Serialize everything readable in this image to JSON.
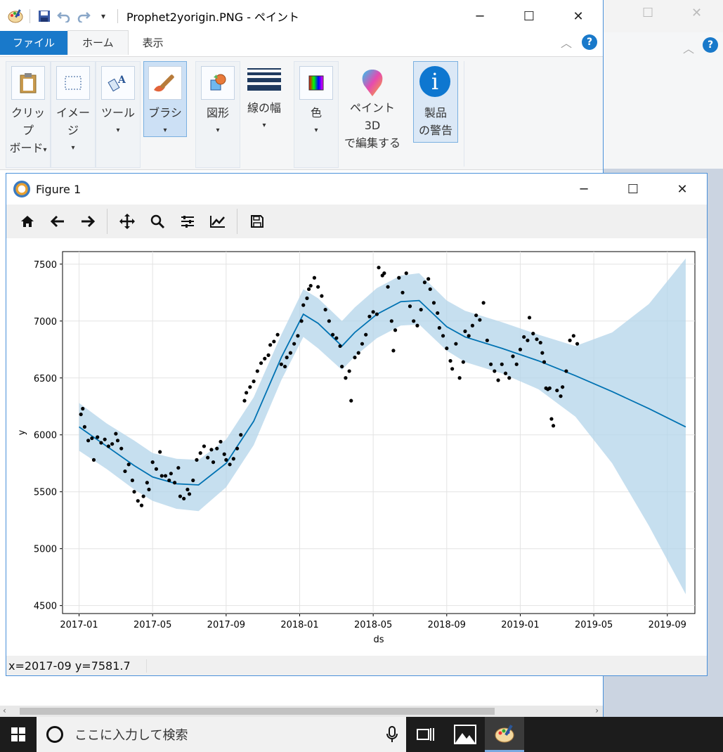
{
  "paint": {
    "title": "Prophet2yorigin.PNG - ペイント",
    "tabs": {
      "file": "ファイル",
      "home": "ホーム",
      "view": "表示"
    },
    "ribbon": {
      "clipboard": [
        "クリップ",
        "ボード"
      ],
      "image": "イメージ",
      "tools": "ツール",
      "brush": "ブラシ",
      "shapes": "図形",
      "size": "線の幅",
      "color": "色",
      "paint3d": [
        "ペイント 3D",
        "で編集する"
      ],
      "warning": [
        "製品",
        "の警告"
      ]
    }
  },
  "figure": {
    "title": "Figure 1",
    "status": "x=2017-09 y=7581.7"
  },
  "taskbar": {
    "search_placeholder": "ここに入力して検索"
  },
  "chart_data": {
    "type": "line",
    "xlabel": "ds",
    "ylabel": "y",
    "x_ticks": [
      "2017-01",
      "2017-05",
      "2017-09",
      "2018-01",
      "2018-05",
      "2018-09",
      "2019-01",
      "2019-05",
      "2019-09"
    ],
    "y_ticks": [
      4500,
      5000,
      5500,
      6000,
      6500,
      7000,
      7500
    ],
    "ylim": [
      4430,
      7610
    ],
    "xlim_months": [
      -0.9,
      33.5
    ],
    "grid": true,
    "series": [
      {
        "kind": "forecast",
        "color": "#0072b2",
        "x_month": [
          0,
          1.5,
          3,
          4,
          5.3,
          6.5,
          8,
          9.5,
          11,
          12.2,
          13,
          14.3,
          15,
          16.2,
          17.5,
          18.5,
          20,
          21,
          23,
          25,
          27,
          29,
          31,
          33
        ],
        "y": [
          6070,
          5900,
          5730,
          5630,
          5570,
          5560,
          5750,
          6120,
          6680,
          7060,
          6980,
          6780,
          6900,
          7060,
          7170,
          7180,
          6950,
          6860,
          6760,
          6650,
          6520,
          6380,
          6230,
          6070
        ],
        "upper": [
          6280,
          6100,
          5950,
          5840,
          5790,
          5780,
          5960,
          6330,
          6880,
          7280,
          7200,
          7000,
          7120,
          7290,
          7400,
          7420,
          7180,
          7090,
          6990,
          6880,
          6780,
          6900,
          7150,
          7550
        ],
        "lower": [
          5860,
          5700,
          5520,
          5420,
          5350,
          5330,
          5540,
          5910,
          6480,
          6860,
          6760,
          6570,
          6690,
          6850,
          6960,
          6970,
          6740,
          6640,
          6540,
          6400,
          6160,
          5750,
          5200,
          4600
        ]
      }
    ],
    "actuals": [
      [
        0.1,
        6180
      ],
      [
        0.2,
        6230
      ],
      [
        0.3,
        6070
      ],
      [
        0.5,
        5950
      ],
      [
        0.7,
        5970
      ],
      [
        0.8,
        5780
      ],
      [
        1.0,
        5980
      ],
      [
        1.2,
        5930
      ],
      [
        1.4,
        5960
      ],
      [
        1.6,
        5900
      ],
      [
        1.8,
        5920
      ],
      [
        2.0,
        6010
      ],
      [
        2.1,
        5950
      ],
      [
        2.3,
        5880
      ],
      [
        2.5,
        5680
      ],
      [
        2.7,
        5740
      ],
      [
        2.9,
        5600
      ],
      [
        3.0,
        5500
      ],
      [
        3.2,
        5420
      ],
      [
        3.4,
        5380
      ],
      [
        3.5,
        5460
      ],
      [
        3.7,
        5580
      ],
      [
        3.8,
        5520
      ],
      [
        4.0,
        5760
      ],
      [
        4.2,
        5700
      ],
      [
        4.4,
        5850
      ],
      [
        4.5,
        5640
      ],
      [
        4.7,
        5640
      ],
      [
        4.9,
        5600
      ],
      [
        5.0,
        5660
      ],
      [
        5.2,
        5580
      ],
      [
        5.4,
        5710
      ],
      [
        5.5,
        5460
      ],
      [
        5.7,
        5440
      ],
      [
        5.9,
        5520
      ],
      [
        6.0,
        5480
      ],
      [
        6.2,
        5600
      ],
      [
        6.4,
        5780
      ],
      [
        6.6,
        5840
      ],
      [
        6.8,
        5900
      ],
      [
        7.0,
        5800
      ],
      [
        7.2,
        5870
      ],
      [
        7.3,
        5760
      ],
      [
        7.5,
        5880
      ],
      [
        7.7,
        5940
      ],
      [
        7.9,
        5830
      ],
      [
        8.0,
        5780
      ],
      [
        8.2,
        5740
      ],
      [
        8.4,
        5790
      ],
      [
        8.6,
        5880
      ],
      [
        8.8,
        6000
      ],
      [
        9.0,
        6300
      ],
      [
        9.1,
        6370
      ],
      [
        9.3,
        6420
      ],
      [
        9.5,
        6470
      ],
      [
        9.7,
        6560
      ],
      [
        9.9,
        6630
      ],
      [
        10.1,
        6670
      ],
      [
        10.3,
        6700
      ],
      [
        10.4,
        6790
      ],
      [
        10.6,
        6820
      ],
      [
        10.8,
        6880
      ],
      [
        11.0,
        6620
      ],
      [
        11.2,
        6600
      ],
      [
        11.3,
        6680
      ],
      [
        11.5,
        6720
      ],
      [
        11.7,
        6800
      ],
      [
        11.9,
        6870
      ],
      [
        12.1,
        7000
      ],
      [
        12.2,
        7140
      ],
      [
        12.4,
        7200
      ],
      [
        12.5,
        7280
      ],
      [
        12.6,
        7310
      ],
      [
        12.8,
        7380
      ],
      [
        13.0,
        7300
      ],
      [
        13.2,
        7220
      ],
      [
        13.4,
        7100
      ],
      [
        13.6,
        7000
      ],
      [
        13.8,
        6880
      ],
      [
        14.0,
        6850
      ],
      [
        14.2,
        6780
      ],
      [
        14.3,
        6600
      ],
      [
        14.5,
        6500
      ],
      [
        14.7,
        6560
      ],
      [
        14.8,
        6300
      ],
      [
        15.0,
        6680
      ],
      [
        15.2,
        6720
      ],
      [
        15.4,
        6800
      ],
      [
        15.6,
        6880
      ],
      [
        15.8,
        7040
      ],
      [
        16.0,
        7080
      ],
      [
        16.2,
        7060
      ],
      [
        16.3,
        7470
      ],
      [
        16.5,
        7400
      ],
      [
        16.6,
        7420
      ],
      [
        16.8,
        7300
      ],
      [
        17.0,
        7000
      ],
      [
        17.1,
        6740
      ],
      [
        17.2,
        6920
      ],
      [
        17.4,
        7380
      ],
      [
        17.6,
        7250
      ],
      [
        17.8,
        7420
      ],
      [
        18.0,
        7130
      ],
      [
        18.2,
        7000
      ],
      [
        18.4,
        6960
      ],
      [
        18.6,
        7100
      ],
      [
        18.8,
        7340
      ],
      [
        19.0,
        7370
      ],
      [
        19.1,
        7280
      ],
      [
        19.3,
        7160
      ],
      [
        19.5,
        7070
      ],
      [
        19.6,
        6940
      ],
      [
        19.8,
        6870
      ],
      [
        20.0,
        6760
      ],
      [
        20.2,
        6650
      ],
      [
        20.3,
        6580
      ],
      [
        20.5,
        6800
      ],
      [
        20.7,
        6500
      ],
      [
        20.9,
        6640
      ],
      [
        21.0,
        6910
      ],
      [
        21.2,
        6870
      ],
      [
        21.4,
        6960
      ],
      [
        21.6,
        7050
      ],
      [
        21.8,
        7010
      ],
      [
        22.0,
        7160
      ],
      [
        22.2,
        6830
      ],
      [
        22.4,
        6620
      ],
      [
        22.6,
        6560
      ],
      [
        22.8,
        6480
      ],
      [
        23.0,
        6620
      ],
      [
        23.2,
        6540
      ],
      [
        23.4,
        6500
      ],
      [
        23.6,
        6690
      ],
      [
        23.8,
        6620
      ],
      [
        24.0,
        6750
      ],
      [
        24.2,
        6860
      ],
      [
        24.4,
        6830
      ],
      [
        24.5,
        7030
      ],
      [
        24.7,
        6890
      ],
      [
        24.9,
        6840
      ],
      [
        25.1,
        6810
      ],
      [
        25.2,
        6720
      ],
      [
        25.3,
        6640
      ],
      [
        25.4,
        6410
      ],
      [
        25.5,
        6400
      ],
      [
        25.6,
        6410
      ],
      [
        25.7,
        6140
      ],
      [
        25.8,
        6080
      ],
      [
        26.0,
        6390
      ],
      [
        26.2,
        6340
      ],
      [
        26.3,
        6420
      ],
      [
        26.5,
        6560
      ],
      [
        26.7,
        6830
      ],
      [
        26.9,
        6870
      ],
      [
        27.1,
        6800
      ]
    ]
  }
}
